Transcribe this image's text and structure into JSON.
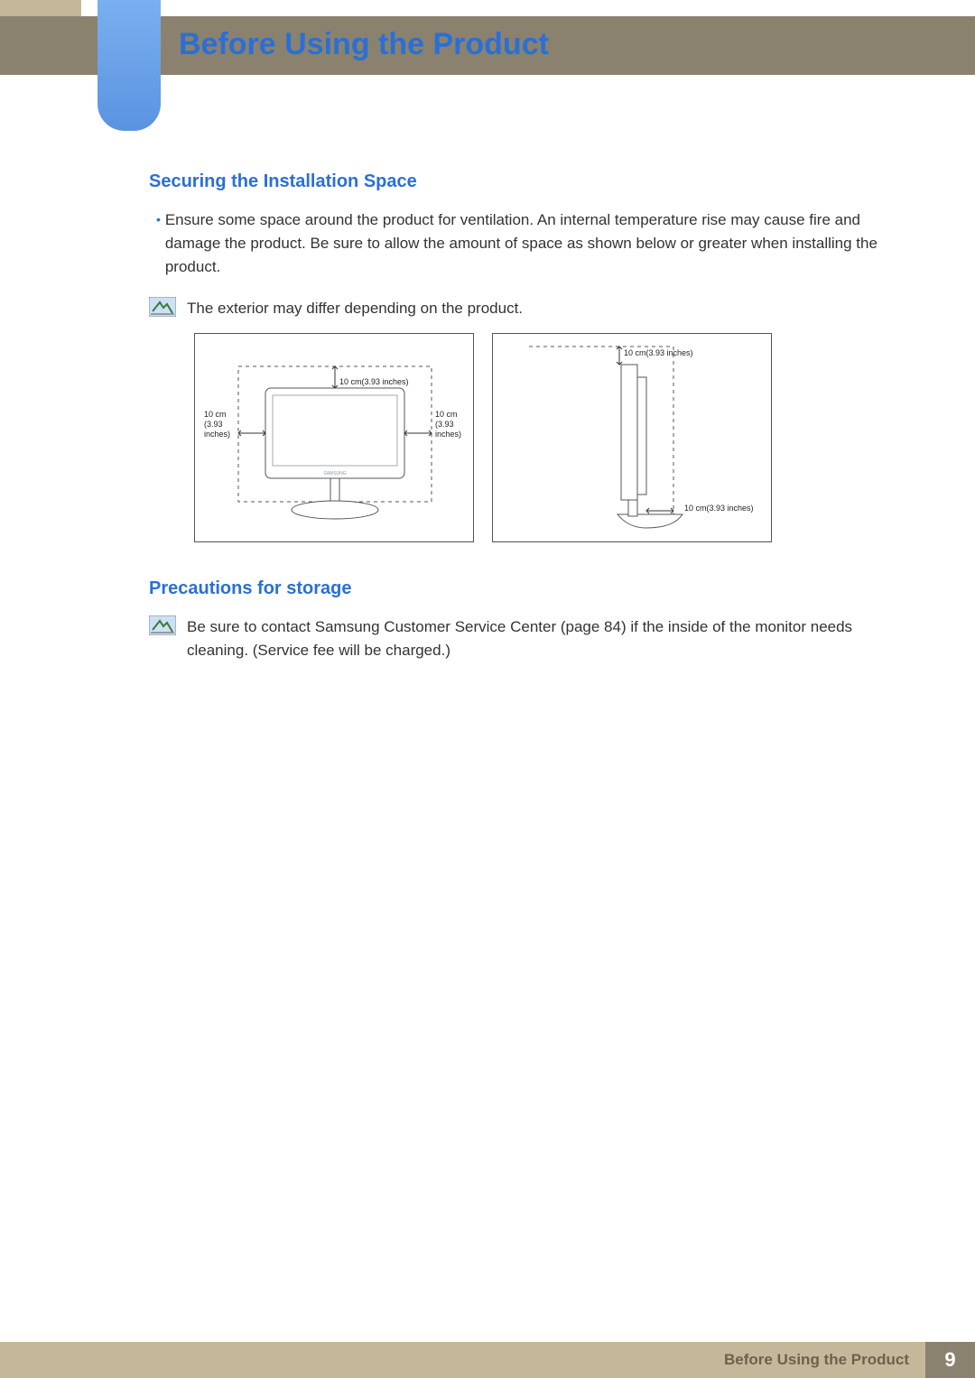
{
  "header": {
    "title": "Before Using the Product"
  },
  "section1": {
    "heading": "Securing the Installation Space",
    "bullet": "Ensure some space around the product for ventilation. An internal temperature rise may cause fire and damage the product. Be sure to allow the amount of space as shown below or greater when installing the product.",
    "note": "The exterior may differ depending on the product.",
    "diagram": {
      "measure_top_front": "10 cm(3.93 inches)",
      "measure_left_front": "10 cm (3.93 inches)",
      "measure_right_front": "10 cm (3.93 inches)",
      "measure_top_side": "10 cm(3.93 inches)",
      "measure_back_side": "10 cm(3.93 inches)",
      "brand": "SAMSUNG"
    }
  },
  "section2": {
    "heading": "Precautions for storage",
    "note": "Be sure to contact Samsung Customer Service Center (page 84) if the inside of the monitor needs cleaning. (Service fee will be charged.)"
  },
  "footer": {
    "text": "Before Using the Product",
    "page": "9"
  }
}
